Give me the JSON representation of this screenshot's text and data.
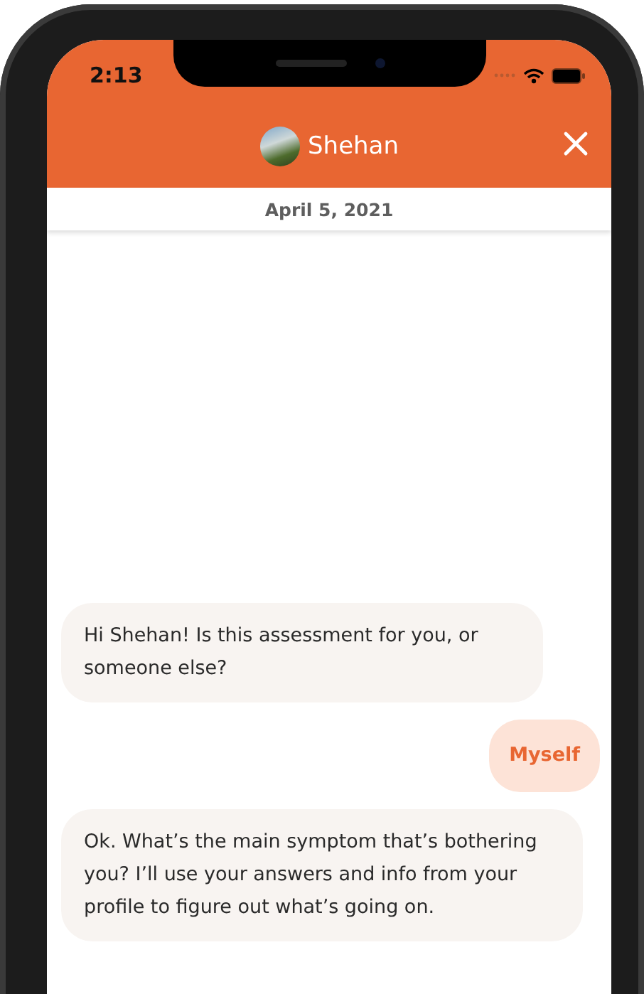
{
  "status_bar": {
    "time": "2:13"
  },
  "header": {
    "contact_name": "Shehan"
  },
  "date_divider": "April 5, 2021",
  "messages": [
    {
      "kind": "bot",
      "text": "Hi Shehan! Is this assessment for you, or someone else?"
    },
    {
      "kind": "user",
      "text": "Myself"
    },
    {
      "kind": "bot",
      "text": "Ok. What’s the main symptom that’s bothering you? I’ll use your answers and info from your profile to figure out what’s going on."
    }
  ]
}
